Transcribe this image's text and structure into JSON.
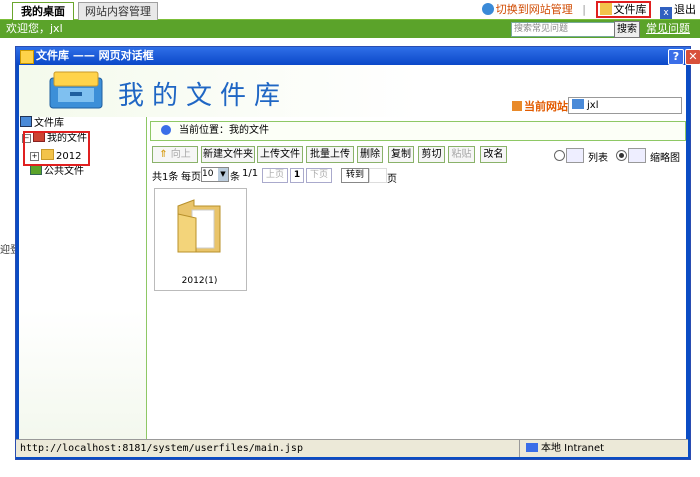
{
  "tabs": {
    "desk": "我的桌面",
    "site_mgmt": "网站内容管理"
  },
  "toplinks": {
    "switch": "切换到网站管理",
    "library": "文件库",
    "logout": "退出"
  },
  "greenbar": {
    "welcome": "欢迎您，jxl",
    "search_placeholder": "搜索常见问题",
    "search_btn": "搜索",
    "faq": "常见问题"
  },
  "background": {
    "fragment": "迎登"
  },
  "dialog": {
    "title": "文件库 —— 网页对话框",
    "help": "?",
    "close": "✕",
    "banner_title": "我的文件库",
    "current_site_label": "当前网站:",
    "current_site_value": "jxl"
  },
  "tree": {
    "root": "文件库",
    "my_files": "我的文件",
    "folder_2012": "2012",
    "public": "公共文件"
  },
  "crumb": "当前位置：我的文件",
  "toolbar": {
    "up": "向上",
    "new_folder": "新建文件夹",
    "upload": "上传文件",
    "batch_upload": "批量上传",
    "delete": "删除",
    "copy": "复制",
    "cut": "剪切",
    "paste": "粘贴",
    "rename": "改名"
  },
  "view": {
    "list": "列表",
    "thumb": "缩略图"
  },
  "pager": {
    "total": "共1条",
    "per_page": "每页",
    "per_value": "10",
    "unit": "条",
    "pages": "1/1",
    "prev": "上页",
    "current": "1",
    "next": "下页",
    "goto": "转到",
    "page_suffix": "页"
  },
  "files": [
    {
      "label": "2012(1)"
    }
  ],
  "status": {
    "url": "http://localhost:8181/system/userfiles/main.jsp",
    "zone": "本地 Intranet"
  },
  "colors": {
    "green": "#5ba32a",
    "dialog_blue": "#0a4cc4",
    "accent_red": "#e02020"
  }
}
